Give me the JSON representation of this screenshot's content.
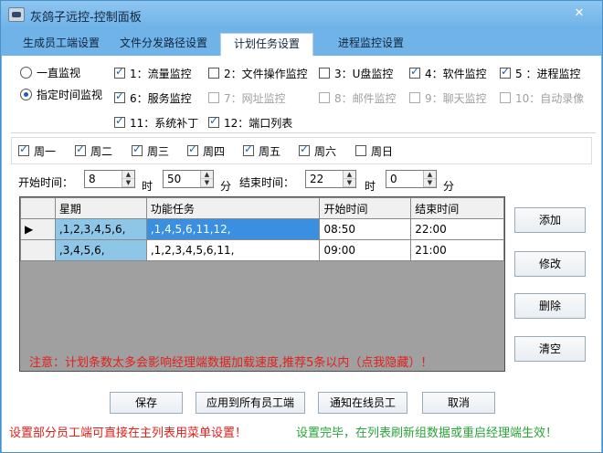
{
  "window": {
    "title": "灰鸽子远控-控制面板",
    "close_glyph": "✕"
  },
  "tabs": [
    {
      "label": "生成员工端设置",
      "active": false
    },
    {
      "label": "文件分发路径设置",
      "active": false
    },
    {
      "label": "计划任务设置",
      "active": true
    },
    {
      "label": "进程监控设置",
      "active": false
    }
  ],
  "mode": [
    {
      "label": "一直监视",
      "checked": false
    },
    {
      "label": "指定时间监视",
      "checked": true
    }
  ],
  "features": [
    {
      "label": "1：流量监控",
      "checked": true,
      "enabled": true
    },
    {
      "label": "2：文件操作监控",
      "checked": false,
      "enabled": true
    },
    {
      "label": "3：U盘监控",
      "checked": false,
      "enabled": true
    },
    {
      "label": "4：软件监控",
      "checked": true,
      "enabled": true
    },
    {
      "label": "5 ：进程监控",
      "checked": true,
      "enabled": true
    },
    {
      "label": "6：服务监控",
      "checked": true,
      "enabled": true
    },
    {
      "label": "7：网址监控",
      "checked": false,
      "enabled": false
    },
    {
      "label": "8：邮件监控",
      "checked": false,
      "enabled": false
    },
    {
      "label": "9：聊天监控",
      "checked": false,
      "enabled": false
    },
    {
      "label": "10：自动录像",
      "checked": false,
      "enabled": false
    },
    {
      "label": "11：系统补丁",
      "checked": true,
      "enabled": true
    },
    {
      "label": "12：端口列表",
      "checked": true,
      "enabled": true
    }
  ],
  "weekdays": [
    {
      "label": "周一",
      "checked": true
    },
    {
      "label": "周二",
      "checked": true
    },
    {
      "label": "周三",
      "checked": true
    },
    {
      "label": "周四",
      "checked": true
    },
    {
      "label": "周五",
      "checked": true
    },
    {
      "label": "周六",
      "checked": true
    },
    {
      "label": "周日",
      "checked": false
    }
  ],
  "time": {
    "start_label": "开始时间：",
    "end_label": "结束时间：",
    "hour_unit": "时",
    "minute_unit": "分",
    "start_hour": "8",
    "start_minute": "50",
    "end_hour": "22",
    "end_minute": "0"
  },
  "grid": {
    "headers": [
      "星期",
      "功能任务",
      "开始时间",
      "结束时间"
    ],
    "rows": [
      {
        "days": ",1,2,3,4,5,6,",
        "tasks": ",1,4,5,6,11,12,",
        "start": "08:50",
        "end": "22:00"
      },
      {
        "days": ",3,4,5,6,",
        "tasks": ",1,2,3,4,5,6,11,",
        "start": "09:00",
        "end": "21:00"
      }
    ],
    "note": "注意：计划条数太多会影响经理端数据加载速度,推荐5条以内（点我隐藏）！"
  },
  "side_buttons": {
    "add": "添加",
    "edit": "修改",
    "delete": "删除",
    "clear": "清空"
  },
  "bottom_buttons": {
    "save": "保存",
    "apply_all": "应用到所有员工端",
    "notify_online": "通知在线员工",
    "cancel": "取消"
  },
  "hints": {
    "left": "设置部分员工端可直接在主列表用菜单设置！",
    "right": "设置完毕，在列表刷新组数据或重启经理端生效！"
  },
  "colors": {
    "title_bar": "#6fb3e8",
    "warning": "#e0201c",
    "success": "#2aa43a",
    "selection": "#3b8fe0"
  }
}
